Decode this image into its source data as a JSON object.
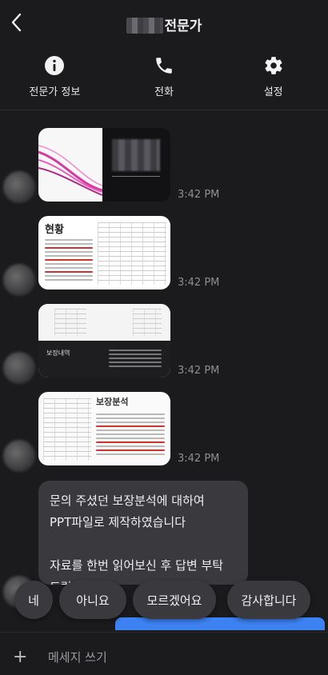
{
  "header": {
    "title": "전문가",
    "actions": [
      {
        "label": "전문가 정보",
        "icon": "info-icon"
      },
      {
        "label": "전화",
        "icon": "phone-icon"
      },
      {
        "label": "설정",
        "icon": "gear-icon"
      }
    ]
  },
  "messages": [
    {
      "type": "image",
      "time": "3:42 PM"
    },
    {
      "type": "image",
      "time": "3:42 PM",
      "heading": "현황"
    },
    {
      "type": "image",
      "time": "3:42 PM",
      "caption": "보장내역"
    },
    {
      "type": "image",
      "time": "3:42 PM",
      "heading": "보장분석"
    }
  ],
  "text_message": {
    "lines": [
      "문의 주셨던 보장분석에 대하여",
      "PPT파일로 제작하였습니다",
      "",
      "자료를 한번 읽어보신 후 답변 부탁",
      "드립니다"
    ]
  },
  "quick_replies": [
    "네",
    "아니요",
    "모르겠어요",
    "감사합니다"
  ],
  "composer": {
    "placeholder": "메세지 쓰기"
  },
  "colors": {
    "background": "#1b1b1d",
    "bubble": "#3a3a3e",
    "accent": "#3d82f3"
  }
}
